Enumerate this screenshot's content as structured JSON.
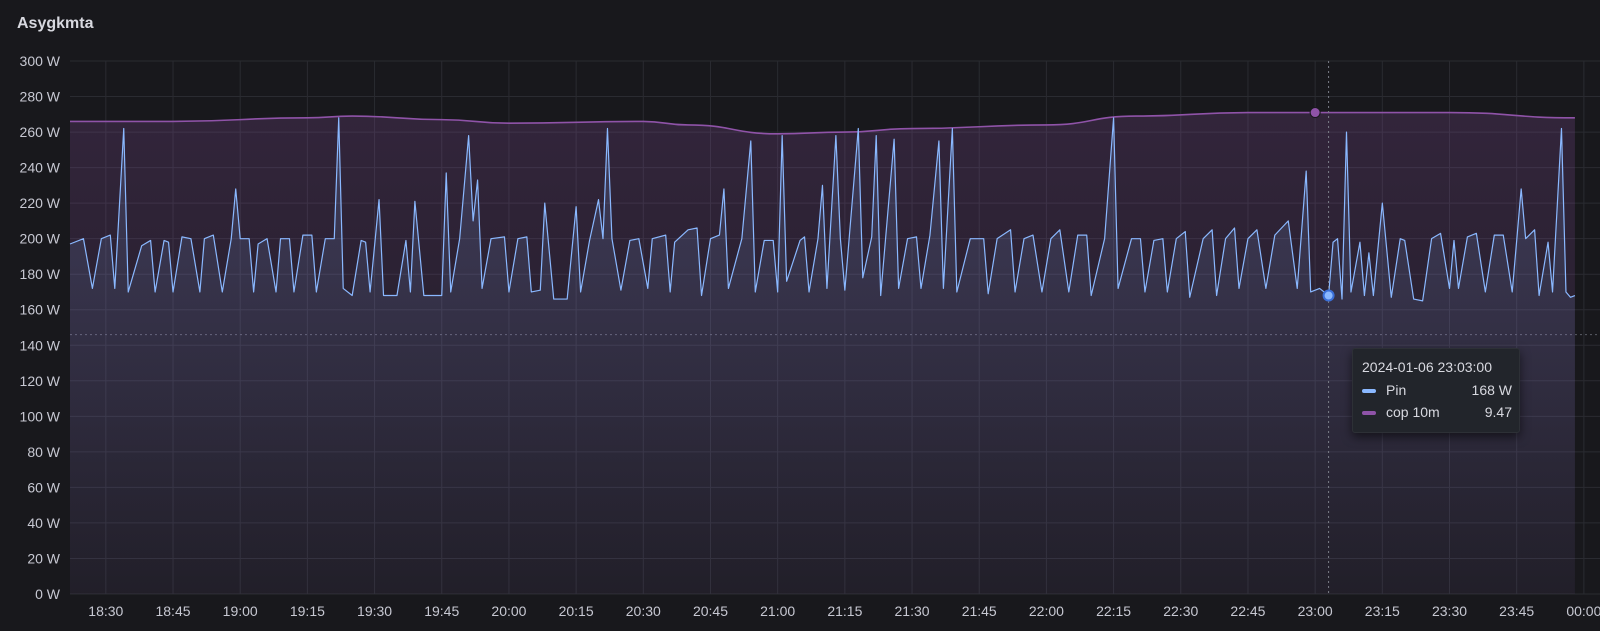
{
  "panel": {
    "title": "Asygkmta"
  },
  "colors": {
    "pin": "#8ab8ff",
    "cop": "#8f53a8",
    "background": "#18181c",
    "grid": "#2a2b31"
  },
  "tooltip": {
    "time": "2024-01-06 23:03:00",
    "rows": [
      {
        "name": "Pin",
        "value": "168 W",
        "color": "#8ab8ff"
      },
      {
        "name": "cop 10m",
        "value": "9.47",
        "color": "#8f53a8"
      }
    ]
  },
  "chart_data": {
    "type": "line",
    "title": "Asygkmta",
    "ylim": [
      0,
      300
    ],
    "y_unit": "W",
    "y_ticks": [
      "0 W",
      "20 W",
      "40 W",
      "60 W",
      "80 W",
      "100 W",
      "120 W",
      "140 W",
      "160 W",
      "180 W",
      "200 W",
      "220 W",
      "240 W",
      "260 W",
      "280 W",
      "300 W"
    ],
    "x_ticks": [
      "18:30",
      "18:45",
      "19:00",
      "19:15",
      "19:30",
      "19:45",
      "20:00",
      "20:15",
      "20:30",
      "20:45",
      "21:00",
      "21:15",
      "21:30",
      "21:45",
      "22:00",
      "22:15",
      "22:30",
      "22:45",
      "23:00",
      "23:15",
      "23:30",
      "23:45",
      "00:00"
    ],
    "x_range": [
      "18:22",
      "00:00"
    ],
    "threshold": 146,
    "crosshair_time": "23:03",
    "series": [
      {
        "name": "Pin",
        "color": "#8ab8ff",
        "points": [
          [
            "18:22",
            197
          ],
          [
            "18:25",
            200
          ],
          [
            "18:27",
            172
          ],
          [
            "18:29",
            200
          ],
          [
            "18:31",
            202
          ],
          [
            "18:32",
            172
          ],
          [
            "18:34",
            262
          ],
          [
            "18:35",
            170
          ],
          [
            "18:38",
            196
          ],
          [
            "18:40",
            199
          ],
          [
            "18:41",
            170
          ],
          [
            "18:43",
            199
          ],
          [
            "18:44",
            198
          ],
          [
            "18:45",
            170
          ],
          [
            "18:47",
            201
          ],
          [
            "18:49",
            200
          ],
          [
            "18:51",
            170
          ],
          [
            "18:52",
            200
          ],
          [
            "18:54",
            202
          ],
          [
            "18:56",
            170
          ],
          [
            "18:58",
            200
          ],
          [
            "18:59",
            228
          ],
          [
            "19:00",
            200
          ],
          [
            "19:02",
            200
          ],
          [
            "19:03",
            170
          ],
          [
            "19:04",
            197
          ],
          [
            "19:06",
            200
          ],
          [
            "19:08",
            170
          ],
          [
            "19:09",
            200
          ],
          [
            "19:11",
            200
          ],
          [
            "19:12",
            170
          ],
          [
            "19:14",
            202
          ],
          [
            "19:16",
            202
          ],
          [
            "19:17",
            170
          ],
          [
            "19:19",
            200
          ],
          [
            "19:21",
            200
          ],
          [
            "19:22",
            268
          ],
          [
            "19:23",
            172
          ],
          [
            "19:25",
            168
          ],
          [
            "19:27",
            199
          ],
          [
            "19:28",
            198
          ],
          [
            "19:29",
            170
          ],
          [
            "19:31",
            222
          ],
          [
            "19:32",
            168
          ],
          [
            "19:35",
            168
          ],
          [
            "19:37",
            199
          ],
          [
            "19:38",
            170
          ],
          [
            "19:39",
            221
          ],
          [
            "19:41",
            168
          ],
          [
            "19:45",
            168
          ],
          [
            "19:46",
            237
          ],
          [
            "19:47",
            170
          ],
          [
            "19:49",
            200
          ],
          [
            "19:51",
            258
          ],
          [
            "19:52",
            210
          ],
          [
            "19:53",
            233
          ],
          [
            "19:54",
            172
          ],
          [
            "19:56",
            200
          ],
          [
            "19:59",
            201
          ],
          [
            "20:00",
            170
          ],
          [
            "20:02",
            200
          ],
          [
            "20:04",
            201
          ],
          [
            "20:05",
            170
          ],
          [
            "20:07",
            171
          ],
          [
            "20:08",
            220
          ],
          [
            "20:10",
            166
          ],
          [
            "20:13",
            166
          ],
          [
            "20:15",
            218
          ],
          [
            "20:16",
            170
          ],
          [
            "20:18",
            199
          ],
          [
            "20:20",
            222
          ],
          [
            "20:21",
            200
          ],
          [
            "20:22",
            262
          ],
          [
            "20:23",
            200
          ],
          [
            "20:25",
            171
          ],
          [
            "20:27",
            199
          ],
          [
            "20:29",
            200
          ],
          [
            "20:31",
            172
          ],
          [
            "20:32",
            200
          ],
          [
            "20:35",
            202
          ],
          [
            "20:36",
            170
          ],
          [
            "20:37",
            198
          ],
          [
            "20:40",
            205
          ],
          [
            "20:42",
            206
          ],
          [
            "20:43",
            168
          ],
          [
            "20:45",
            200
          ],
          [
            "20:47",
            202
          ],
          [
            "20:48",
            228
          ],
          [
            "20:49",
            172
          ],
          [
            "20:52",
            200
          ],
          [
            "20:54",
            255
          ],
          [
            "20:55",
            170
          ],
          [
            "20:57",
            199
          ],
          [
            "20:59",
            199
          ],
          [
            "21:00",
            170
          ],
          [
            "21:01",
            258
          ],
          [
            "21:02",
            176
          ],
          [
            "21:05",
            199
          ],
          [
            "21:06",
            201
          ],
          [
            "21:07",
            170
          ],
          [
            "21:09",
            200
          ],
          [
            "21:10",
            230
          ],
          [
            "21:11",
            172
          ],
          [
            "21:13",
            258
          ],
          [
            "21:14",
            200
          ],
          [
            "21:15",
            171
          ],
          [
            "21:18",
            262
          ],
          [
            "21:19",
            178
          ],
          [
            "21:21",
            201
          ],
          [
            "21:22",
            258
          ],
          [
            "21:23",
            168
          ],
          [
            "21:26",
            256
          ],
          [
            "21:27",
            172
          ],
          [
            "21:29",
            200
          ],
          [
            "21:31",
            201
          ],
          [
            "21:32",
            172
          ],
          [
            "21:34",
            202
          ],
          [
            "21:36",
            255
          ],
          [
            "21:37",
            172
          ],
          [
            "21:39",
            262
          ],
          [
            "21:40",
            170
          ],
          [
            "21:43",
            200
          ],
          [
            "21:46",
            200
          ],
          [
            "21:47",
            169
          ],
          [
            "21:49",
            200
          ],
          [
            "21:52",
            205
          ],
          [
            "21:53",
            170
          ],
          [
            "21:55",
            200
          ],
          [
            "21:57",
            202
          ],
          [
            "21:59",
            170
          ],
          [
            "22:01",
            200
          ],
          [
            "22:03",
            205
          ],
          [
            "22:05",
            170
          ],
          [
            "22:07",
            202
          ],
          [
            "22:09",
            202
          ],
          [
            "22:10",
            168
          ],
          [
            "22:13",
            200
          ],
          [
            "22:15",
            268
          ],
          [
            "22:16",
            172
          ],
          [
            "22:19",
            200
          ],
          [
            "22:21",
            200
          ],
          [
            "22:22",
            170
          ],
          [
            "22:24",
            199
          ],
          [
            "22:26",
            200
          ],
          [
            "22:27",
            170
          ],
          [
            "22:29",
            200
          ],
          [
            "22:31",
            204
          ],
          [
            "22:32",
            167
          ],
          [
            "22:35",
            200
          ],
          [
            "22:37",
            205
          ],
          [
            "22:38",
            168
          ],
          [
            "22:40",
            200
          ],
          [
            "22:42",
            206
          ],
          [
            "22:43",
            172
          ],
          [
            "22:45",
            200
          ],
          [
            "22:47",
            205
          ],
          [
            "22:49",
            172
          ],
          [
            "22:51",
            202
          ],
          [
            "22:54",
            210
          ],
          [
            "22:56",
            172
          ],
          [
            "22:58",
            238
          ],
          [
            "22:59",
            170
          ],
          [
            "23:01",
            172
          ],
          [
            "23:03",
            168
          ],
          [
            "23:04",
            198
          ],
          [
            "23:05",
            200
          ],
          [
            "23:06",
            166
          ],
          [
            "23:07",
            260
          ],
          [
            "23:08",
            170
          ],
          [
            "23:10",
            198
          ],
          [
            "23:11",
            168
          ],
          [
            "23:12",
            192
          ],
          [
            "23:13",
            168
          ],
          [
            "23:15",
            220
          ],
          [
            "23:17",
            167
          ],
          [
            "23:19",
            200
          ],
          [
            "23:20",
            199
          ],
          [
            "23:22",
            166
          ],
          [
            "23:24",
            165
          ],
          [
            "23:26",
            200
          ],
          [
            "23:28",
            203
          ],
          [
            "23:30",
            172
          ],
          [
            "23:31",
            199
          ],
          [
            "23:32",
            172
          ],
          [
            "23:34",
            201
          ],
          [
            "23:36",
            203
          ],
          [
            "23:38",
            170
          ],
          [
            "23:40",
            202
          ],
          [
            "23:42",
            202
          ],
          [
            "23:44",
            170
          ],
          [
            "23:46",
            228
          ],
          [
            "23:47",
            200
          ],
          [
            "23:49",
            205
          ],
          [
            "23:50",
            168
          ],
          [
            "23:52",
            198
          ],
          [
            "23:53",
            170
          ],
          [
            "23:55",
            262
          ],
          [
            "23:56",
            170
          ],
          [
            "23:57",
            167
          ],
          [
            "23:58",
            168
          ]
        ]
      },
      {
        "name": "cop 10m",
        "color": "#8f53a8",
        "points": [
          [
            "18:22",
            266
          ],
          [
            "18:45",
            266
          ],
          [
            "19:15",
            268
          ],
          [
            "19:25",
            269
          ],
          [
            "19:45",
            267
          ],
          [
            "20:00",
            265
          ],
          [
            "20:30",
            266
          ],
          [
            "20:40",
            264
          ],
          [
            "21:00",
            259
          ],
          [
            "21:15",
            260
          ],
          [
            "21:30",
            262
          ],
          [
            "22:00",
            264
          ],
          [
            "22:20",
            269
          ],
          [
            "22:45",
            271
          ],
          [
            "23:00",
            271
          ],
          [
            "23:30",
            271
          ],
          [
            "23:58",
            268
          ]
        ]
      }
    ]
  }
}
